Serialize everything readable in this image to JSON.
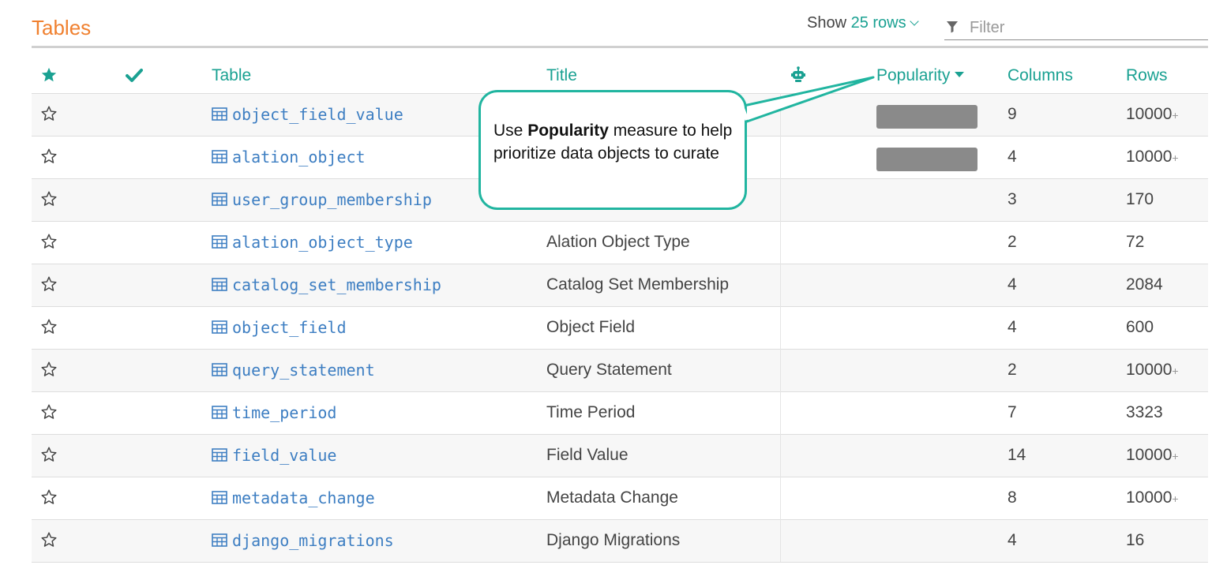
{
  "page": {
    "title": "Tables"
  },
  "toolbar": {
    "show_label": "Show",
    "rows_value": "25 rows",
    "filter_placeholder": "Filter"
  },
  "columns": {
    "table": "Table",
    "title": "Title",
    "popularity": "Popularity",
    "columns": "Columns",
    "rows": "Rows"
  },
  "callout": {
    "bold": "Popularity",
    "prefix": "Use ",
    "suffix": " measure to help prioritize data objects to curate"
  },
  "rows": [
    {
      "name": "object_field_value",
      "title": "",
      "popularity_bar": true,
      "columns": "9",
      "rows": "10000",
      "plus": "+"
    },
    {
      "name": "alation_object",
      "title": "",
      "popularity_bar": true,
      "columns": "4",
      "rows": "10000",
      "plus": "+"
    },
    {
      "name": "user_group_membership",
      "title": "",
      "popularity_bar": false,
      "columns": "3",
      "rows": "170",
      "plus": ""
    },
    {
      "name": "alation_object_type",
      "title": "Alation Object Type",
      "popularity_bar": false,
      "columns": "2",
      "rows": "72",
      "plus": ""
    },
    {
      "name": "catalog_set_membership",
      "title": "Catalog Set Membership",
      "popularity_bar": false,
      "columns": "4",
      "rows": "2084",
      "plus": ""
    },
    {
      "name": "object_field",
      "title": "Object Field",
      "popularity_bar": false,
      "columns": "4",
      "rows": "600",
      "plus": ""
    },
    {
      "name": "query_statement",
      "title": "Query Statement",
      "popularity_bar": false,
      "columns": "2",
      "rows": "10000",
      "plus": "+"
    },
    {
      "name": "time_period",
      "title": "Time Period",
      "popularity_bar": false,
      "columns": "7",
      "rows": "3323",
      "plus": ""
    },
    {
      "name": "field_value",
      "title": "Field Value",
      "popularity_bar": false,
      "columns": "14",
      "rows": "10000",
      "plus": "+"
    },
    {
      "name": "metadata_change",
      "title": "Metadata Change",
      "popularity_bar": false,
      "columns": "8",
      "rows": "10000",
      "plus": "+"
    },
    {
      "name": "django_migrations",
      "title": "Django Migrations",
      "popularity_bar": false,
      "columns": "4",
      "rows": "16",
      "plus": ""
    }
  ],
  "colors": {
    "accent": "#1aa192",
    "title": "#f0802f",
    "link": "#3d7ec2",
    "callout_border": "#21b5a0"
  },
  "icons": [
    "filter-icon",
    "star-filled-icon",
    "check-icon",
    "robot-icon",
    "sort-desc-icon",
    "star-outline-icon",
    "table-grid-icon"
  ]
}
